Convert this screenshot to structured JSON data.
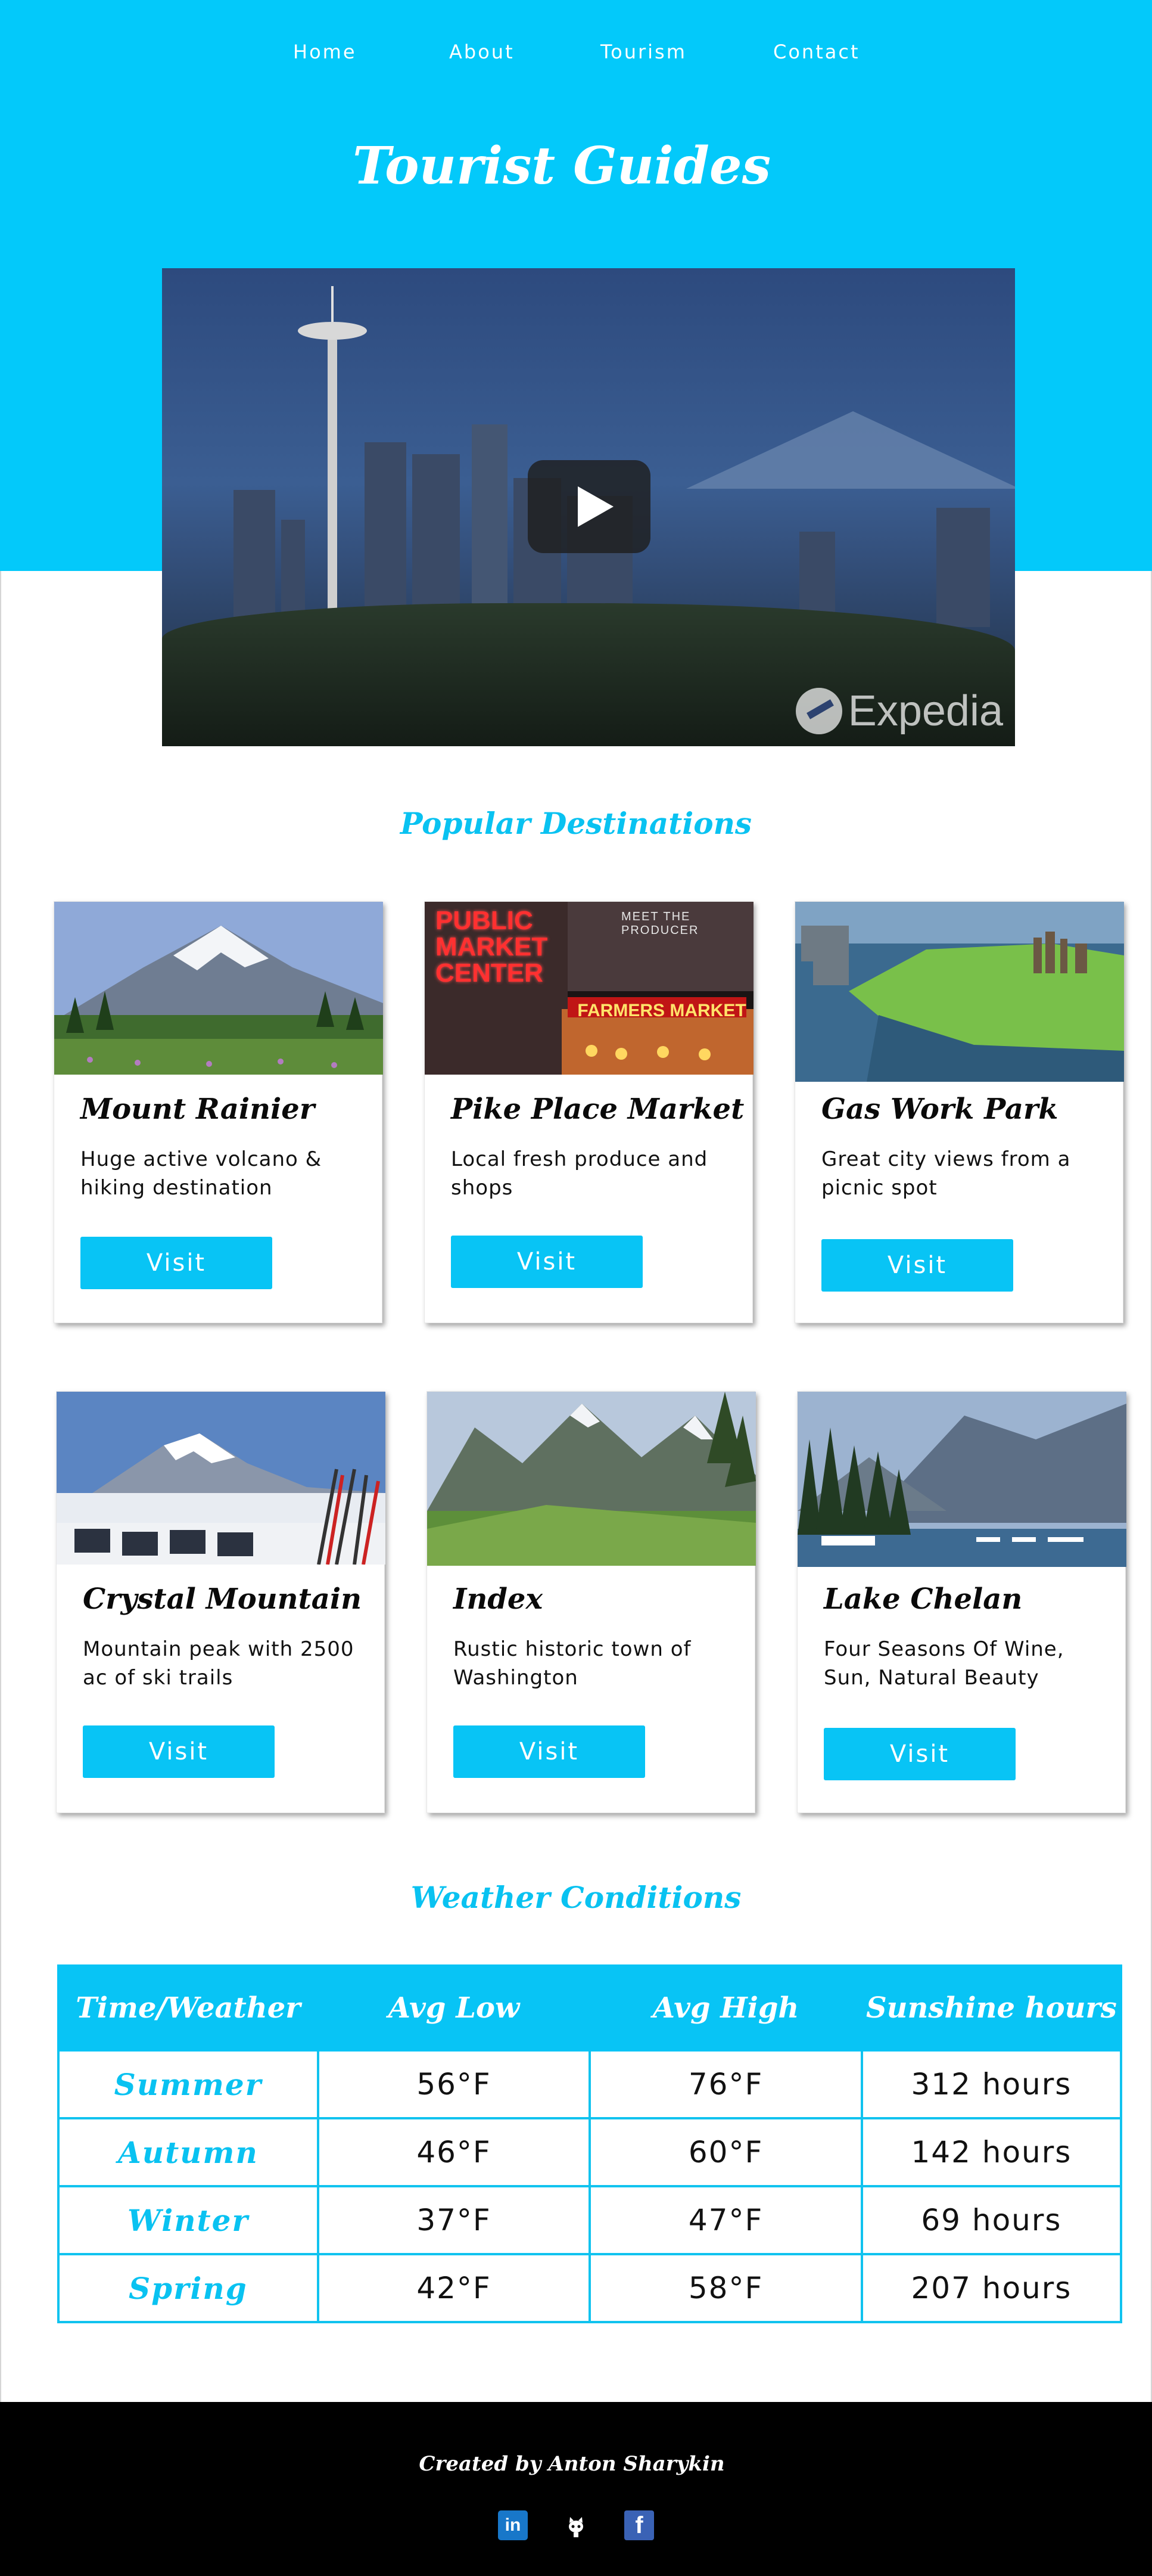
{
  "nav": {
    "items": [
      {
        "label": "Home"
      },
      {
        "label": "About"
      },
      {
        "label": "Tourism"
      },
      {
        "label": "Contact"
      }
    ]
  },
  "hero": {
    "title": "Tourist Guides"
  },
  "video": {
    "watermark": "Expedia",
    "play_icon": "play-icon"
  },
  "destinations": {
    "section_title": "Popular Destinations",
    "cards": [
      {
        "title": "Mount Rainier",
        "description": "Huge active volcano & hiking destination",
        "button": "Visit"
      },
      {
        "title": "Pike Place Market",
        "description": "Local fresh produce and shops",
        "button": "Visit"
      },
      {
        "title": "Gas Work Park",
        "description": "Great city views from a picnic spot",
        "button": "Visit"
      },
      {
        "title": "Crystal Mountain",
        "description": "Mountain peak with 2500 ac of ski trails",
        "button": "Visit"
      },
      {
        "title": "Index",
        "description": "Rustic historic town of Washington",
        "button": "Visit"
      },
      {
        "title": "Lake Chelan",
        "description": "Four Seasons Of Wine, Sun, Natural Beauty",
        "button": "Visit"
      }
    ],
    "image_signs": {
      "public_market": "PUBLIC MARKET CENTER",
      "farmers_market": "FARMERS MARKET",
      "meet_the_producer": "MEET THE PRODUCER"
    }
  },
  "weather": {
    "section_title": "Weather Conditions",
    "headers": [
      "Time/Weather",
      "Avg Low",
      "Avg High",
      "Sunshine hours"
    ],
    "rows": [
      [
        "Summer",
        "56°F",
        "76°F",
        "312 hours"
      ],
      [
        "Autumn",
        "46°F",
        "60°F",
        "142 hours"
      ],
      [
        "Winter",
        "37°F",
        "47°F",
        "69 hours"
      ],
      [
        "Spring",
        "42°F",
        "58°F",
        "207 hours"
      ]
    ]
  },
  "footer": {
    "credit": "Created by Anton Sharykin",
    "social": [
      {
        "name": "linkedin-icon",
        "glyph": "in"
      },
      {
        "name": "github-icon",
        "glyph": ""
      },
      {
        "name": "facebook-icon",
        "glyph": "f"
      }
    ]
  },
  "colors": {
    "accent": "#03c9fa",
    "button": "#08c4f5",
    "footer": "#000000"
  }
}
